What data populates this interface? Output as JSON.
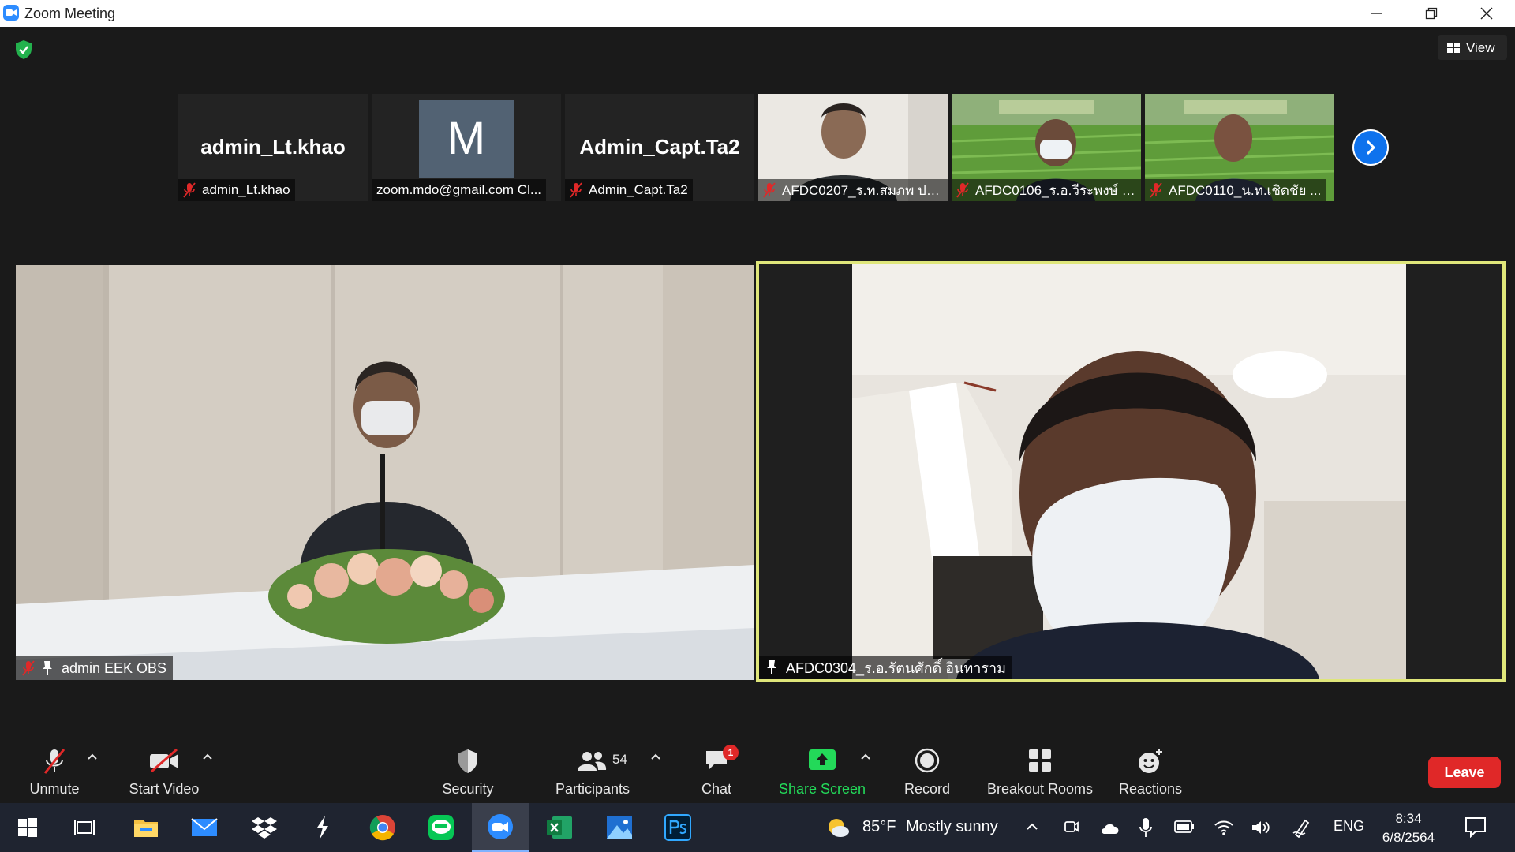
{
  "window": {
    "title": "Zoom Meeting"
  },
  "top": {
    "view_label": "View"
  },
  "thumbnails": [
    {
      "big_label": "admin_Lt.khao",
      "name": "admin_Lt.khao",
      "muted": true
    },
    {
      "avatar_letter": "M",
      "name": "zoom.mdo@gmail.com Cl...",
      "muted": false
    },
    {
      "big_label": "Admin_Capt.Ta2",
      "name": "Admin_Capt.Ta2",
      "muted": true
    },
    {
      "name": "AFDC0207_ร.ท.สมภพ ปร...",
      "muted": true
    },
    {
      "name": "AFDC0106_ร.อ.วีระพงษ์ จิ...",
      "muted": true
    },
    {
      "name": "AFDC0110_น.ท.เชิดชัย  ...",
      "muted": true
    }
  ],
  "main_tiles": [
    {
      "name": "admin EEK OBS",
      "muted": true,
      "pinned": true
    },
    {
      "name": "AFDC0304_ร.อ.รัตนศักดิ์ อินทาราม",
      "muted": false,
      "pinned": true
    }
  ],
  "toolbar": {
    "unmute": "Unmute",
    "start_video": "Start Video",
    "security": "Security",
    "participants": "Participants",
    "participants_count": "54",
    "chat": "Chat",
    "chat_badge": "1",
    "share_screen": "Share Screen",
    "record": "Record",
    "breakout_rooms": "Breakout Rooms",
    "reactions": "Reactions",
    "leave": "Leave"
  },
  "taskbar": {
    "weather_temp": "85°F",
    "weather_text": "Mostly sunny",
    "language": "ENG",
    "time": "8:34",
    "date": "6/8/2564"
  },
  "colors": {
    "zoom_blue": "#2D8CFF",
    "active_speaker_border": "#dfe67a",
    "share_green": "#23D959",
    "leave_red": "#E02828",
    "muted_red": "#E02828"
  }
}
